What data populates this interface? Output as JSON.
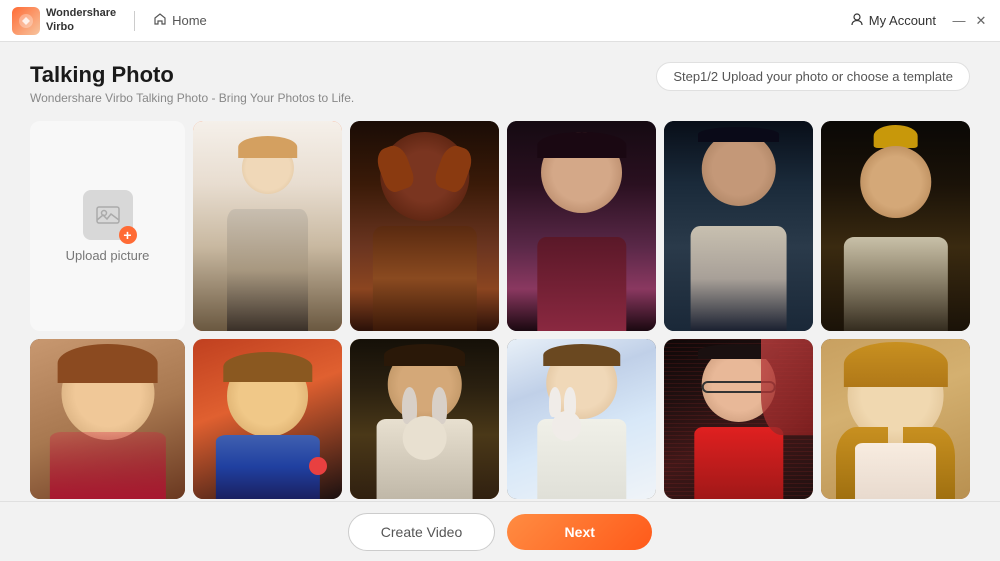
{
  "app": {
    "name_line1": "Wondershare",
    "name_line2": "Virbo"
  },
  "titlebar": {
    "home_label": "Home",
    "account_label": "My Account",
    "minimize_symbol": "—",
    "close_symbol": "✕"
  },
  "page": {
    "title": "Talking Photo",
    "subtitle": "Wondershare Virbo Talking Photo - Bring Your Photos to Life.",
    "step_indicator": "Step1/2 Upload your photo or choose a template"
  },
  "upload": {
    "label": "Upload picture"
  },
  "photos": [
    {
      "id": 1,
      "selected": true,
      "css_class": "photo-1"
    },
    {
      "id": 2,
      "selected": false,
      "css_class": "photo-2"
    },
    {
      "id": 3,
      "selected": false,
      "css_class": "photo-3"
    },
    {
      "id": 4,
      "selected": false,
      "css_class": "photo-4"
    },
    {
      "id": 5,
      "selected": false,
      "css_class": "photo-5"
    },
    {
      "id": 6,
      "selected": false,
      "css_class": "photo-6"
    },
    {
      "id": 7,
      "selected": false,
      "css_class": "photo-7"
    },
    {
      "id": 8,
      "selected": false,
      "css_class": "photo-8"
    },
    {
      "id": 9,
      "selected": false,
      "css_class": "photo-9"
    },
    {
      "id": 10,
      "selected": false,
      "css_class": "photo-10"
    },
    {
      "id": 11,
      "selected": false,
      "css_class": "photo-11"
    },
    {
      "id": 12,
      "selected": false,
      "css_class": "photo-12"
    }
  ],
  "buttons": {
    "create_video": "Create Video",
    "next": "Next"
  },
  "colors": {
    "accent": "#ff6b35",
    "selected_border": "#ff6b35"
  }
}
